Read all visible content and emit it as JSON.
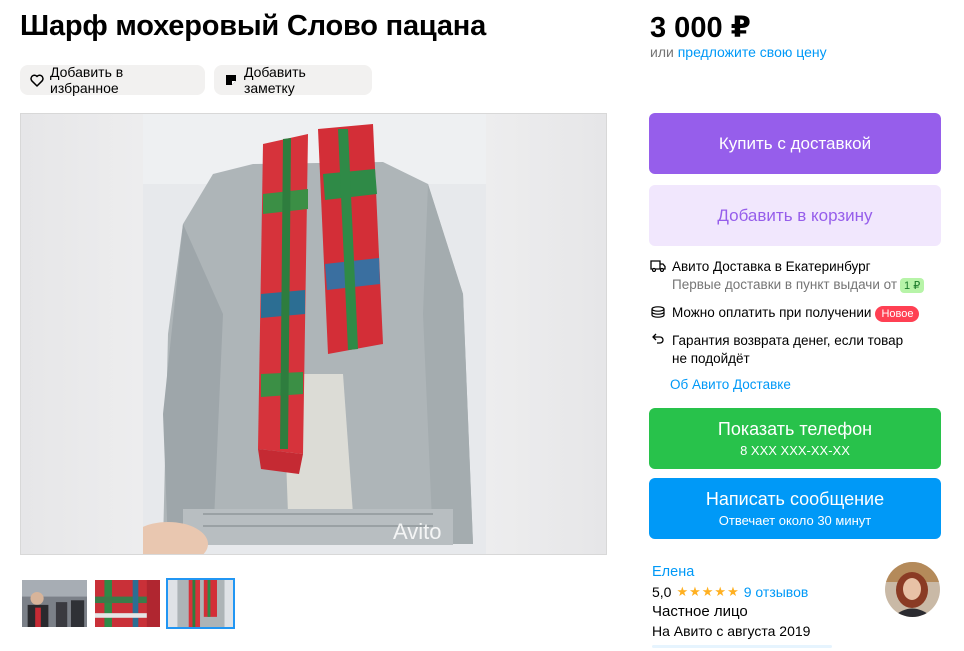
{
  "listing": {
    "title": "Шарф мохеровый Слово пацана",
    "price": "3 000 ₽",
    "offer_prefix": "или ",
    "offer_link": "предложите свою цену"
  },
  "actions": {
    "favorite_label": "Добавить в избранное",
    "note_label": "Добавить заметку",
    "buy_label": "Купить с доставкой",
    "cart_label": "Добавить в корзину",
    "phone_label": "Показать телефон",
    "phone_number": "8 XXX XXX-XX-XX",
    "message_label": "Написать сообщение",
    "message_sub": "Отвечает около 30 минут"
  },
  "delivery": {
    "title": "Авито Доставка в Екатеринбург",
    "first_delivery": "Первые доставки в пункт выдачи от",
    "first_delivery_price": "1 ₽",
    "pay_on_receipt": "Можно оплатить при получении",
    "new_badge": "Новое",
    "guarantee_line1": "Гарантия возврата денег, если товар",
    "guarantee_line2": "не подойдёт",
    "about_link": "Об Авито Доставке"
  },
  "gallery": {
    "watermark": "Avito",
    "thumbnails": 3,
    "active_index": 2
  },
  "seller": {
    "name": "Елена",
    "rating": "5,0",
    "stars": "★★★★★",
    "reviews": "9 отзывов",
    "type": "Частное лицо",
    "since": "На Авито с августа 2019"
  },
  "colors": {
    "purple": "#965eeb",
    "purple_light": "#f1e7fd",
    "green": "#28c24b",
    "blue": "#0099f7",
    "new_badge": "#ff4053",
    "star": "#ffb021"
  },
  "icons": [
    "heart-icon",
    "note-icon",
    "truck-icon",
    "coins-icon",
    "return-arrow-icon"
  ]
}
